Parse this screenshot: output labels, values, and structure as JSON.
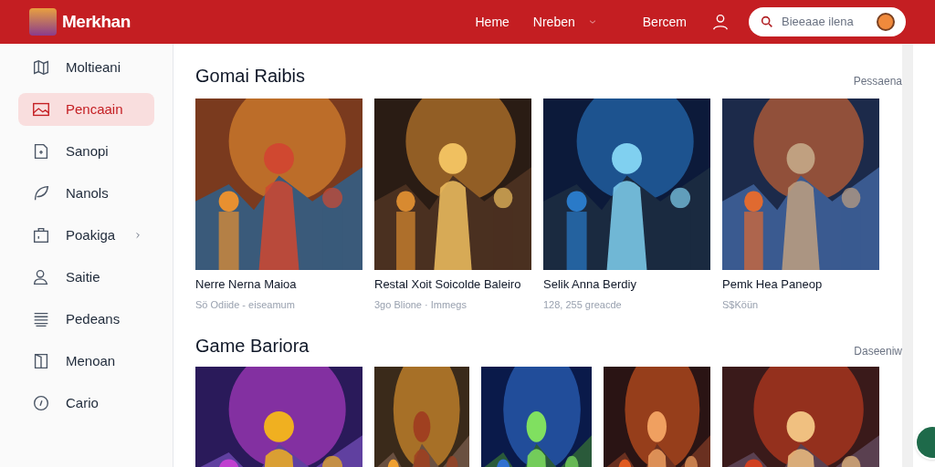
{
  "header": {
    "brand": "Merkhan",
    "nav": [
      {
        "label": "Heme",
        "dropdown": false
      },
      {
        "label": "Nreben",
        "dropdown": true
      },
      {
        "label": "Bercem",
        "dropdown": false
      }
    ],
    "search": {
      "placeholder": "Bieeaae ilena"
    }
  },
  "sidebar": {
    "items": [
      {
        "label": "Moltieani",
        "selected": false,
        "expandable": false
      },
      {
        "label": "Pencaain",
        "selected": true,
        "expandable": false
      },
      {
        "label": "Sanopi",
        "selected": false,
        "expandable": false
      },
      {
        "label": "Nanols",
        "selected": false,
        "expandable": false
      },
      {
        "label": "Poakiga",
        "selected": false,
        "expandable": true
      },
      {
        "label": "Saitie",
        "selected": false,
        "expandable": false
      },
      {
        "label": "Pedeans",
        "selected": false,
        "expandable": false
      },
      {
        "label": "Menoan",
        "selected": false,
        "expandable": false
      },
      {
        "label": "Cario",
        "selected": false,
        "expandable": false
      }
    ]
  },
  "sections": [
    {
      "title": "Gomai Raibis",
      "link": "Pessaena",
      "cards": [
        {
          "kind": "picture",
          "title": "Nerre Nerna Maioa",
          "subtitle": "Sö Odiide - eiseamum"
        },
        {
          "kind": "picture",
          "title": "Restal Xoit Soicolde Baleiro",
          "subtitle": "3go Blione · Immegs"
        },
        {
          "kind": "picture",
          "title": "Selik Anna Berdiy",
          "subtitle": "128, 255 greacde"
        },
        {
          "kind": "picture",
          "title": "Pemk Hea Paneop",
          "subtitle": "S$Köün"
        }
      ]
    },
    {
      "title": "Game Bariora",
      "link": "Daseeniw"
    }
  ]
}
